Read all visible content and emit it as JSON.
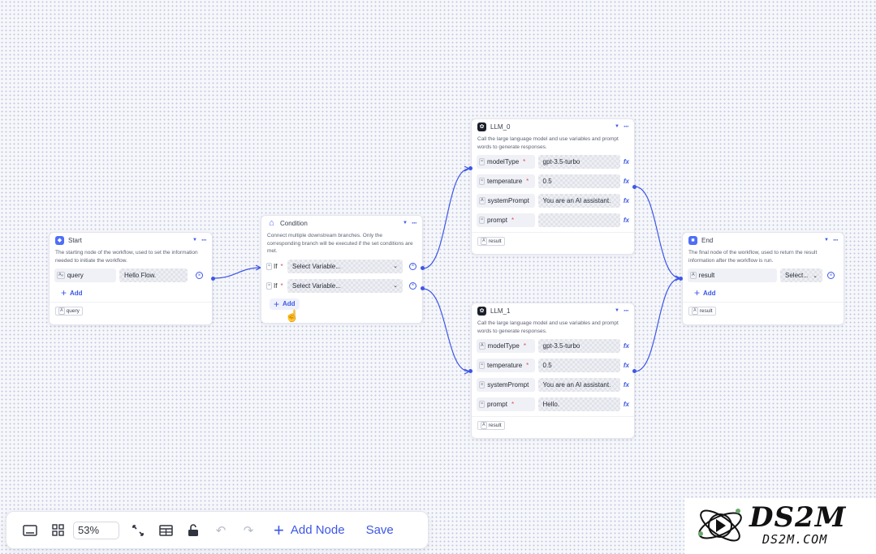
{
  "nodes": {
    "start": {
      "title": "Start",
      "description": "The starting node of the workflow, used to set the information needed to initiate the workflow.",
      "param_name": "query",
      "param_type": "Aₐ",
      "param_value": "Hello Flow.",
      "add_label": "Add",
      "output": "query"
    },
    "condition": {
      "title": "Condition",
      "description": "Connect multiple downstream branches. Only the corresponding branch will be executed if the set conditions are met.",
      "if_label": "If",
      "select_placeholder": "Select Variable...",
      "add_label": "Add"
    },
    "llm0": {
      "title": "LLM_0",
      "description": "Call the large language model and use variables and prompt words to generate responses.",
      "params": [
        {
          "name": "modelType",
          "value": "gpt-3.5-turbo"
        },
        {
          "name": "temperature",
          "value": "0.5"
        },
        {
          "name": "systemPrompt",
          "value": "You are an AI assistant."
        },
        {
          "name": "prompt",
          "value": ""
        }
      ],
      "output": "result"
    },
    "llm1": {
      "title": "LLM_1",
      "description": "Call the large language model and use variables and prompt words to generate responses.",
      "params": [
        {
          "name": "modelType",
          "value": "gpt-3.5-turbo"
        },
        {
          "name": "temperature",
          "value": "0.5"
        },
        {
          "name": "systemPrompt",
          "value": "You are an AI assistant."
        },
        {
          "name": "prompt",
          "value": "Hello."
        }
      ],
      "output": "result"
    },
    "end": {
      "title": "End",
      "description": "The final node of the workflow, used to return the result information after the workflow is run.",
      "param_name": "result",
      "select_placeholder": "Select...",
      "add_label": "Add",
      "output": "result"
    }
  },
  "toolbar": {
    "zoom": "53%",
    "add_node_label": "Add Node",
    "save_label": "Save"
  },
  "logo": {
    "main": "DS2M",
    "sub": "DS2M.COM"
  },
  "colors": {
    "accent": "#3d57e6",
    "edge": "#3d57e6",
    "node_icon_blue": "#4f6ef7",
    "required": "#e5484d"
  }
}
